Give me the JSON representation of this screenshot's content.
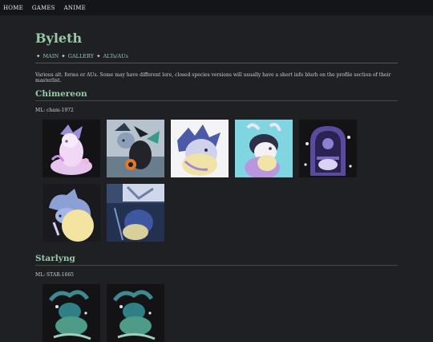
{
  "nav": [
    "HOME",
    "GAMES",
    "ANIME"
  ],
  "page": {
    "title": "Byleth",
    "breadcrumb": [
      {
        "label": "MAIN"
      },
      {
        "label": "GALLERY"
      },
      {
        "label": "ALTs/AUs"
      }
    ],
    "breadcrumb_sep": "✦",
    "description": "Various alt. forms or AUs. Some may have different lore, closed species versions will usually have a short info blurb on the profile section of their masterlist."
  },
  "sections": [
    {
      "title": "Chimereon",
      "ml": "ML: cham-1972"
    },
    {
      "title": "Starlyng",
      "ml": "ML: STAR-1665"
    }
  ],
  "colors": {
    "accent": "#97c9a9",
    "background": "#1f2023",
    "nav_bg": "#141517"
  }
}
